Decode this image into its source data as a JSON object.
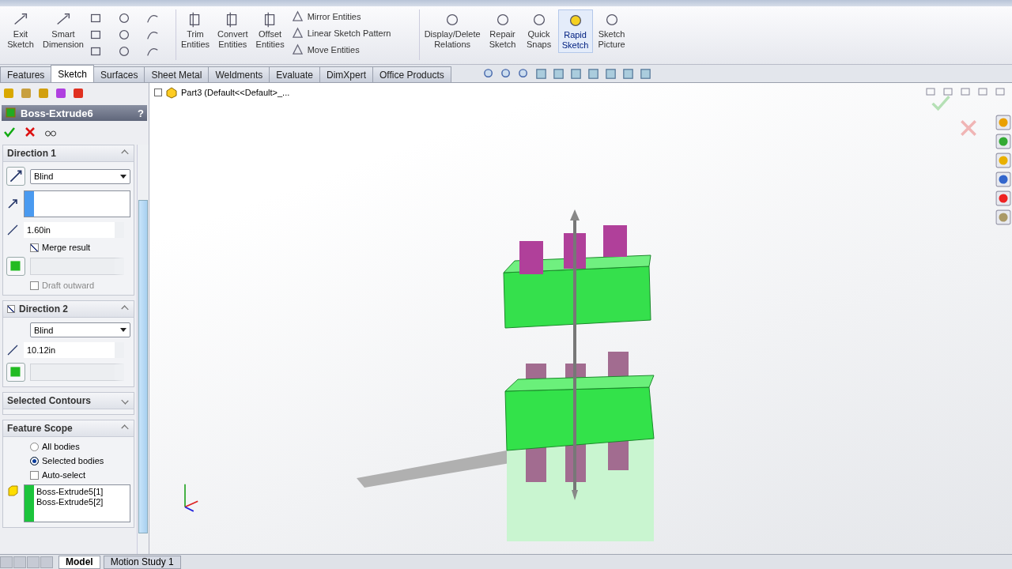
{
  "ribbon": {
    "large_tools": [
      {
        "label": "Exit Sketch",
        "selected": false
      },
      {
        "label": "Smart Dimension",
        "selected": false
      }
    ],
    "middle_tools": [
      {
        "label": "Trim Entities",
        "selected": false
      },
      {
        "label": "Convert Entities",
        "selected": false
      },
      {
        "label": "Offset Entities",
        "selected": false
      }
    ],
    "list_tools": [
      "Mirror Entities",
      "Linear Sketch Pattern",
      "Move Entities"
    ],
    "right_tools": [
      {
        "label": "Display/Delete Relations",
        "selected": false
      },
      {
        "label": "Repair Sketch",
        "selected": false
      },
      {
        "label": "Quick Snaps",
        "selected": false
      },
      {
        "label": "Rapid Sketch",
        "selected": true
      },
      {
        "label": "Sketch Picture",
        "selected": false
      }
    ]
  },
  "tabs": [
    {
      "label": "Features",
      "selected": false
    },
    {
      "label": "Sketch",
      "selected": true
    },
    {
      "label": "Surfaces",
      "selected": false
    },
    {
      "label": "Sheet Metal",
      "selected": false
    },
    {
      "label": "Weldments",
      "selected": false
    },
    {
      "label": "Evaluate",
      "selected": false
    },
    {
      "label": "DimXpert",
      "selected": false
    },
    {
      "label": "Office Products",
      "selected": false
    }
  ],
  "tree_item": "Part3  (Default<<Default>_...",
  "property_manager": {
    "title": "Boss-Extrude6",
    "help": "?",
    "direction1": {
      "title": "Direction 1",
      "end_condition": "Blind",
      "depth": "1.60in",
      "merge_result": true,
      "merge_label": "Merge result",
      "draft_outward": false,
      "draft_label": "Draft outward"
    },
    "direction2": {
      "title": "Direction 2",
      "checked": true,
      "end_condition": "Blind",
      "depth": "10.12in"
    },
    "selected_contours": {
      "title": "Selected Contours",
      "expanded": false
    },
    "feature_scope": {
      "title": "Feature Scope",
      "expanded": true,
      "options": [
        {
          "label": "All bodies",
          "selected": false
        },
        {
          "label": "Selected bodies",
          "selected": true
        }
      ],
      "auto_select": false,
      "auto_select_label": "Auto-select",
      "bodies": [
        "Boss-Extrude5[1]",
        "Boss-Extrude5[2]"
      ]
    }
  },
  "bottom_tabs": [
    {
      "label": "Model",
      "selected": true
    },
    {
      "label": "Motion Study 1",
      "selected": false
    }
  ]
}
